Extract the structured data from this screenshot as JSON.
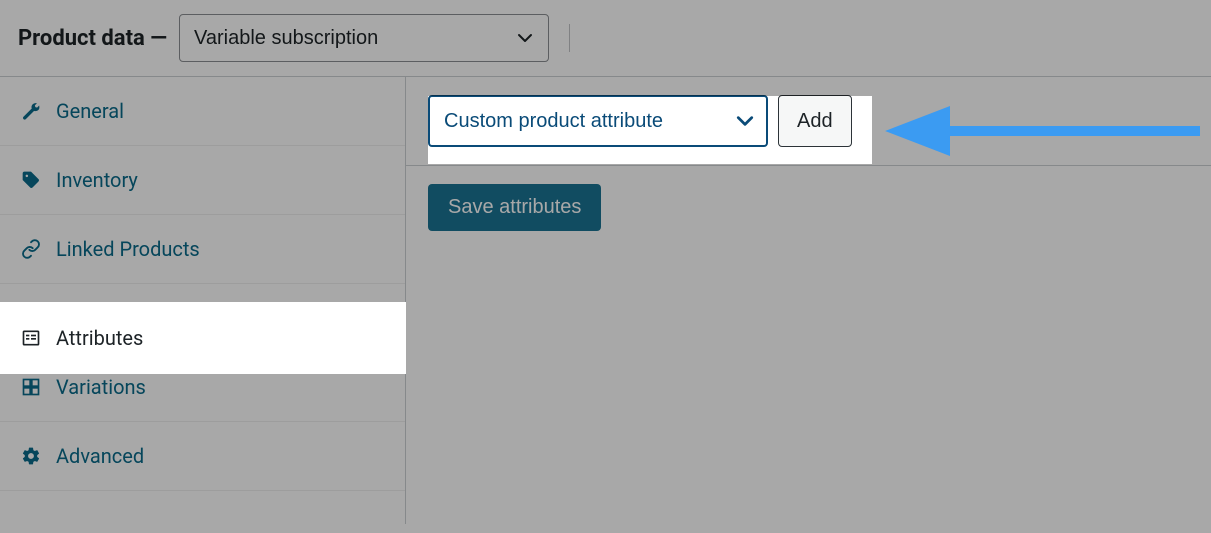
{
  "header": {
    "title": "Product data —",
    "product_type_selected": "Variable subscription"
  },
  "sidebar": {
    "tabs": [
      {
        "id": "general",
        "label": "General",
        "icon": "wrench-icon",
        "active": false
      },
      {
        "id": "inventory",
        "label": "Inventory",
        "icon": "tag-icon",
        "active": false
      },
      {
        "id": "linked",
        "label": "Linked Products",
        "icon": "link-icon",
        "active": false
      },
      {
        "id": "attributes",
        "label": "Attributes",
        "icon": "list-icon",
        "active": true
      },
      {
        "id": "variations",
        "label": "Variations",
        "icon": "grid-icon",
        "active": false
      },
      {
        "id": "advanced",
        "label": "Advanced",
        "icon": "gear-icon",
        "active": false
      }
    ]
  },
  "main": {
    "attribute_select": "Custom product attribute",
    "add_button": "Add",
    "save_button": "Save attributes"
  }
}
